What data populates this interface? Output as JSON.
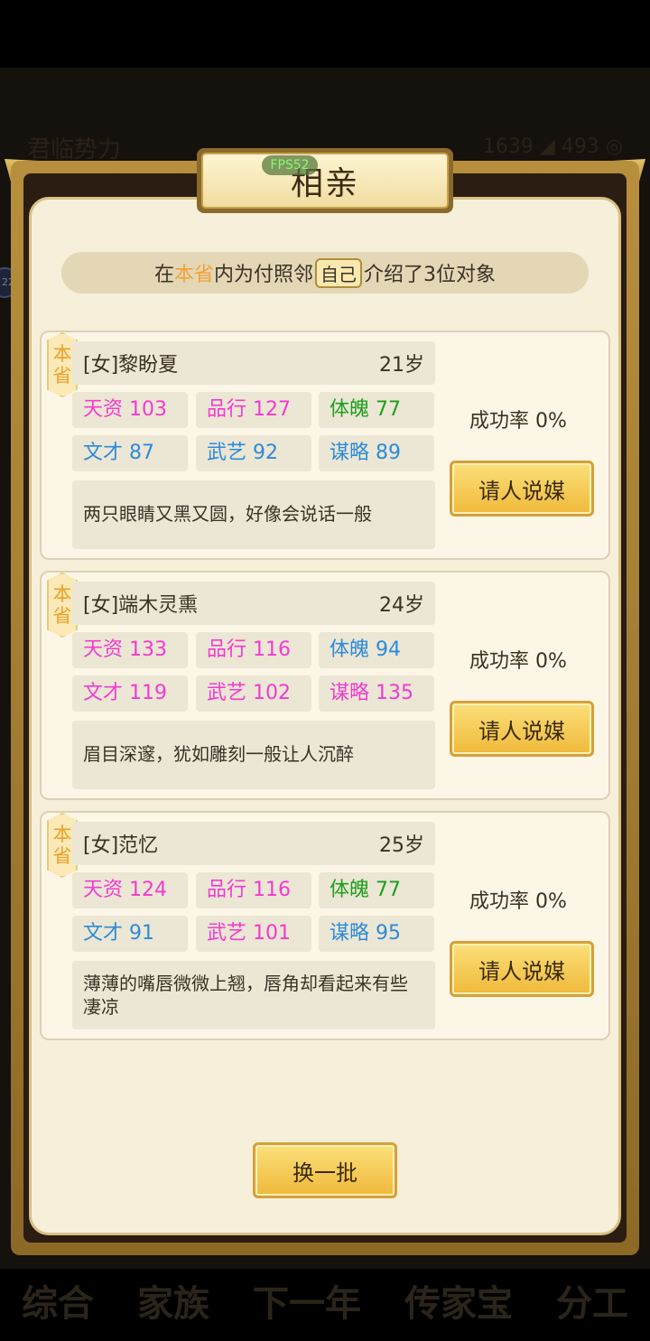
{
  "background": {
    "top_left_title": "君临势力",
    "top_right_stats": "1639 ◢ 493 ◎",
    "badge": "22",
    "nav": [
      "综合",
      "家族",
      "下一年",
      "传家宝",
      "分工"
    ]
  },
  "fps_label": "FPS52",
  "dialog": {
    "title": "相亲",
    "intro_prefix": "在",
    "intro_province": "本省",
    "intro_middle": "内为付照邻",
    "intro_self": "自己",
    "intro_suffix": "介绍了3位对象",
    "matchmaker_label": "请人说媒",
    "refresh_label": "换一批"
  },
  "candidates": [
    {
      "tag": [
        "本",
        "省"
      ],
      "name": "[女]黎盼夏",
      "age": "21岁",
      "stats": [
        {
          "label": "天资",
          "value": "103",
          "color": "pink"
        },
        {
          "label": "品行",
          "value": "127",
          "color": "pink"
        },
        {
          "label": "体魄",
          "value": "77",
          "color": "green"
        },
        {
          "label": "文才",
          "value": "87",
          "color": "blue"
        },
        {
          "label": "武艺",
          "value": "92",
          "color": "blue"
        },
        {
          "label": "谋略",
          "value": "89",
          "color": "blue"
        }
      ],
      "description": "两只眼睛又黑又圆，好像会说话一般",
      "success_rate": "成功率 0%"
    },
    {
      "tag": [
        "本",
        "省"
      ],
      "name": "[女]端木灵熏",
      "age": "24岁",
      "stats": [
        {
          "label": "天资",
          "value": "133",
          "color": "pink"
        },
        {
          "label": "品行",
          "value": "116",
          "color": "pink"
        },
        {
          "label": "体魄",
          "value": "94",
          "color": "blue"
        },
        {
          "label": "文才",
          "value": "119",
          "color": "pink"
        },
        {
          "label": "武艺",
          "value": "102",
          "color": "pink"
        },
        {
          "label": "谋略",
          "value": "135",
          "color": "pink"
        }
      ],
      "description": "眉目深邃，犹如雕刻一般让人沉醉",
      "success_rate": "成功率 0%"
    },
    {
      "tag": [
        "本",
        "省"
      ],
      "name": "[女]范忆",
      "age": "25岁",
      "stats": [
        {
          "label": "天资",
          "value": "124",
          "color": "pink"
        },
        {
          "label": "品行",
          "value": "116",
          "color": "pink"
        },
        {
          "label": "体魄",
          "value": "77",
          "color": "green"
        },
        {
          "label": "文才",
          "value": "91",
          "color": "blue"
        },
        {
          "label": "武艺",
          "value": "101",
          "color": "pink"
        },
        {
          "label": "谋略",
          "value": "95",
          "color": "blue"
        }
      ],
      "description": "薄薄的嘴唇微微上翘，唇角却看起来有些凄凉",
      "success_rate": "成功率 0%"
    }
  ],
  "colors": {
    "pink": "#f33ad1",
    "green": "#1ca01c",
    "blue": "#2b8bd9",
    "province": "#f2a23a"
  }
}
